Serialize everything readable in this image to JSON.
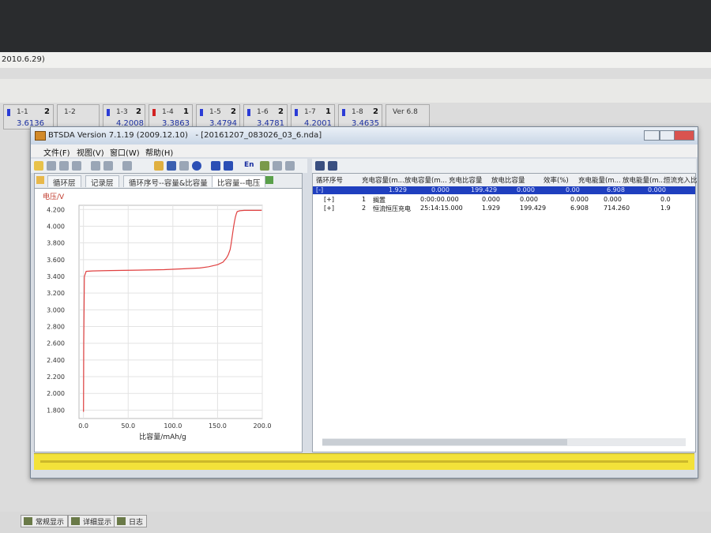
{
  "outer_window": {
    "title_fragment": "2010.6.29)"
  },
  "channels": [
    {
      "name": "1-1",
      "num": "2",
      "value": "3.6136",
      "icon": "battery-icon",
      "color": "#2b3cd6"
    },
    {
      "name": "1-2",
      "num": "",
      "value": "",
      "icon": "",
      "color": ""
    },
    {
      "name": "1-3",
      "num": "2",
      "value": "4.2008",
      "icon": "battery-icon",
      "color": "#2b3cd6"
    },
    {
      "name": "1-4",
      "num": "1",
      "value": "3.3863",
      "icon": "battery-icon",
      "color": "#d22222"
    },
    {
      "name": "1-5",
      "num": "2",
      "value": "3.4794",
      "icon": "battery-icon",
      "color": "#2b3cd6"
    },
    {
      "name": "1-6",
      "num": "2",
      "value": "3.4781",
      "icon": "battery-icon",
      "color": "#2b3cd6"
    },
    {
      "name": "1-7",
      "num": "1",
      "value": "4.2001",
      "icon": "battery-icon",
      "color": "#2b3cd6"
    },
    {
      "name": "1-8",
      "num": "2",
      "value": "3.4635",
      "icon": "battery-icon",
      "color": "#2b3cd6"
    },
    {
      "name": "Ver 6.8",
      "num": "",
      "value": "",
      "icon": "",
      "color": ""
    }
  ],
  "window": {
    "title": "BTSDA Version 7.1.19 (2009.12.10)   - [20161207_083026_03_6.nda]",
    "menu": [
      "文件(F)",
      "视图(V)",
      "窗口(W)",
      "帮助(H)"
    ],
    "toolbar_en": "En"
  },
  "tabs": [
    "循环层",
    "记录层",
    "循环序号--容量&比容量",
    "比容量--电压"
  ],
  "active_tab": 3,
  "chart_data": {
    "type": "line",
    "ylabel": "电压/V",
    "xlabel": "比容量/mAh/g",
    "xlim": [
      -5,
      200
    ],
    "ylim": [
      1.7,
      4.25
    ],
    "xticks": [
      "0.0",
      "50.0",
      "100.0",
      "150.0",
      "200.0"
    ],
    "yticks": [
      "1.800",
      "2.000",
      "2.200",
      "2.400",
      "2.600",
      "2.800",
      "3.000",
      "3.200",
      "3.400",
      "3.600",
      "3.800",
      "4.000",
      "4.200"
    ],
    "series": [
      {
        "color": "#e04040",
        "x": [
          0,
          0.3,
          1,
          3,
          10,
          30,
          60,
          90,
          110,
          130,
          140,
          150,
          156,
          160,
          162,
          164,
          165,
          166,
          167,
          168,
          169,
          170,
          171,
          172,
          175,
          180,
          185,
          199.4
        ],
        "y": [
          1.78,
          2.6,
          3.4,
          3.46,
          3.465,
          3.47,
          3.475,
          3.48,
          3.49,
          3.5,
          3.515,
          3.54,
          3.57,
          3.62,
          3.66,
          3.72,
          3.78,
          3.85,
          3.93,
          4.0,
          4.06,
          4.11,
          4.15,
          4.175,
          4.185,
          4.19,
          4.19,
          4.19
        ]
      }
    ]
  },
  "table": {
    "headers": [
      "循环序号",
      "充电容量(m...",
      "放电容量(m...",
      "充电比容量",
      "放电比容量",
      "效率(%)",
      "充电能量(m...",
      "放电能量(m...",
      "恒流充入比"
    ],
    "summary_row": [
      "[-]",
      "1.929",
      "0.000",
      "199.429",
      "0.000",
      "0.00",
      "6.908",
      "0.000"
    ],
    "rows": [
      [
        "[+]",
        "1",
        "搁置",
        "0:00:00.000",
        "0.000",
        "0.000",
        "0.000",
        "0.000",
        "0.0"
      ],
      [
        "[+]",
        "2",
        "恒流恒压充电",
        "25:14:15.000",
        "1.929",
        "199.429",
        "6.908",
        "714.260",
        "1.9"
      ]
    ]
  },
  "bottom_tabs": [
    "常规显示",
    "详细显示",
    "日志"
  ]
}
